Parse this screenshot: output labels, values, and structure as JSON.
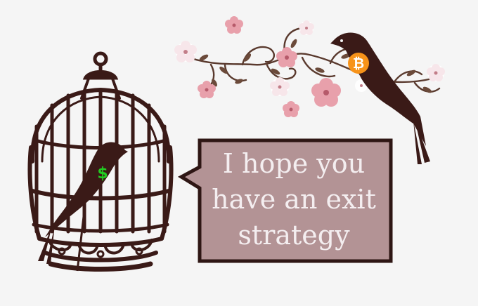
{
  "speech_bubble": {
    "lines": [
      "I hope you",
      "have an exit",
      "strategy"
    ]
  },
  "caged_bird": {
    "symbol": "$",
    "symbol_color": "#22cc22"
  },
  "free_bird": {
    "symbol": "₿",
    "badge_color": "#f7931a"
  },
  "colors": {
    "background": "#f5f5f5",
    "silhouette": "#3a1a17",
    "bubble_fill": "#b39395",
    "bubble_border": "#2e1614",
    "blossom": "#e8a0ab"
  }
}
